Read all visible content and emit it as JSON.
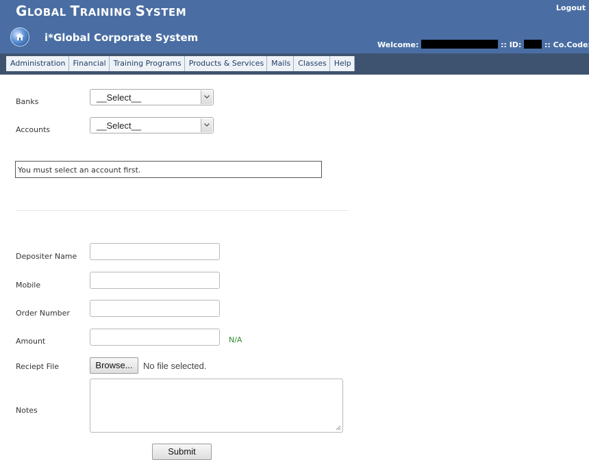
{
  "header": {
    "brand_first": "G",
    "brand_rest_1": "LOBAL ",
    "brand_t": "T",
    "brand_rest_2": "RAINING ",
    "brand_s": "S",
    "brand_rest_3": "YSTEM",
    "logout_label": "Logout",
    "system_name": "i*Global Corporate System",
    "welcome_label": "Welcome:",
    "id_label": ":: ID:",
    "cocode_label": ":: Co.Code:",
    "logo_icon": "globe-house-icon"
  },
  "nav": {
    "items": [
      {
        "label": "Administration"
      },
      {
        "label": "Financial"
      },
      {
        "label": "Training Programs"
      },
      {
        "label": "Products & Services"
      },
      {
        "label": "Mails"
      },
      {
        "label": "Classes"
      },
      {
        "label": "Help"
      }
    ]
  },
  "form": {
    "banks_label": "Banks",
    "banks_value": "__Select__",
    "accounts_label": "Accounts",
    "accounts_value": "__Select__",
    "account_message": "You must select an account first.",
    "depositer_label": "Depositer Name",
    "depositer_value": "",
    "mobile_label": "Mobile",
    "mobile_value": "",
    "order_label": "Order Number",
    "order_value": "",
    "amount_label": "Amount",
    "amount_value": "",
    "amount_hint": "N/A",
    "receipt_label": "Reciept File",
    "browse_label": "Browse...",
    "no_file_label": "No file selected.",
    "notes_label": "Notes",
    "notes_value": "",
    "submit_label": "Submit"
  },
  "colors": {
    "header_bg": "#4a6ea3",
    "nav_bg": "#3e5370",
    "hint_green": "#2e8b2e"
  }
}
